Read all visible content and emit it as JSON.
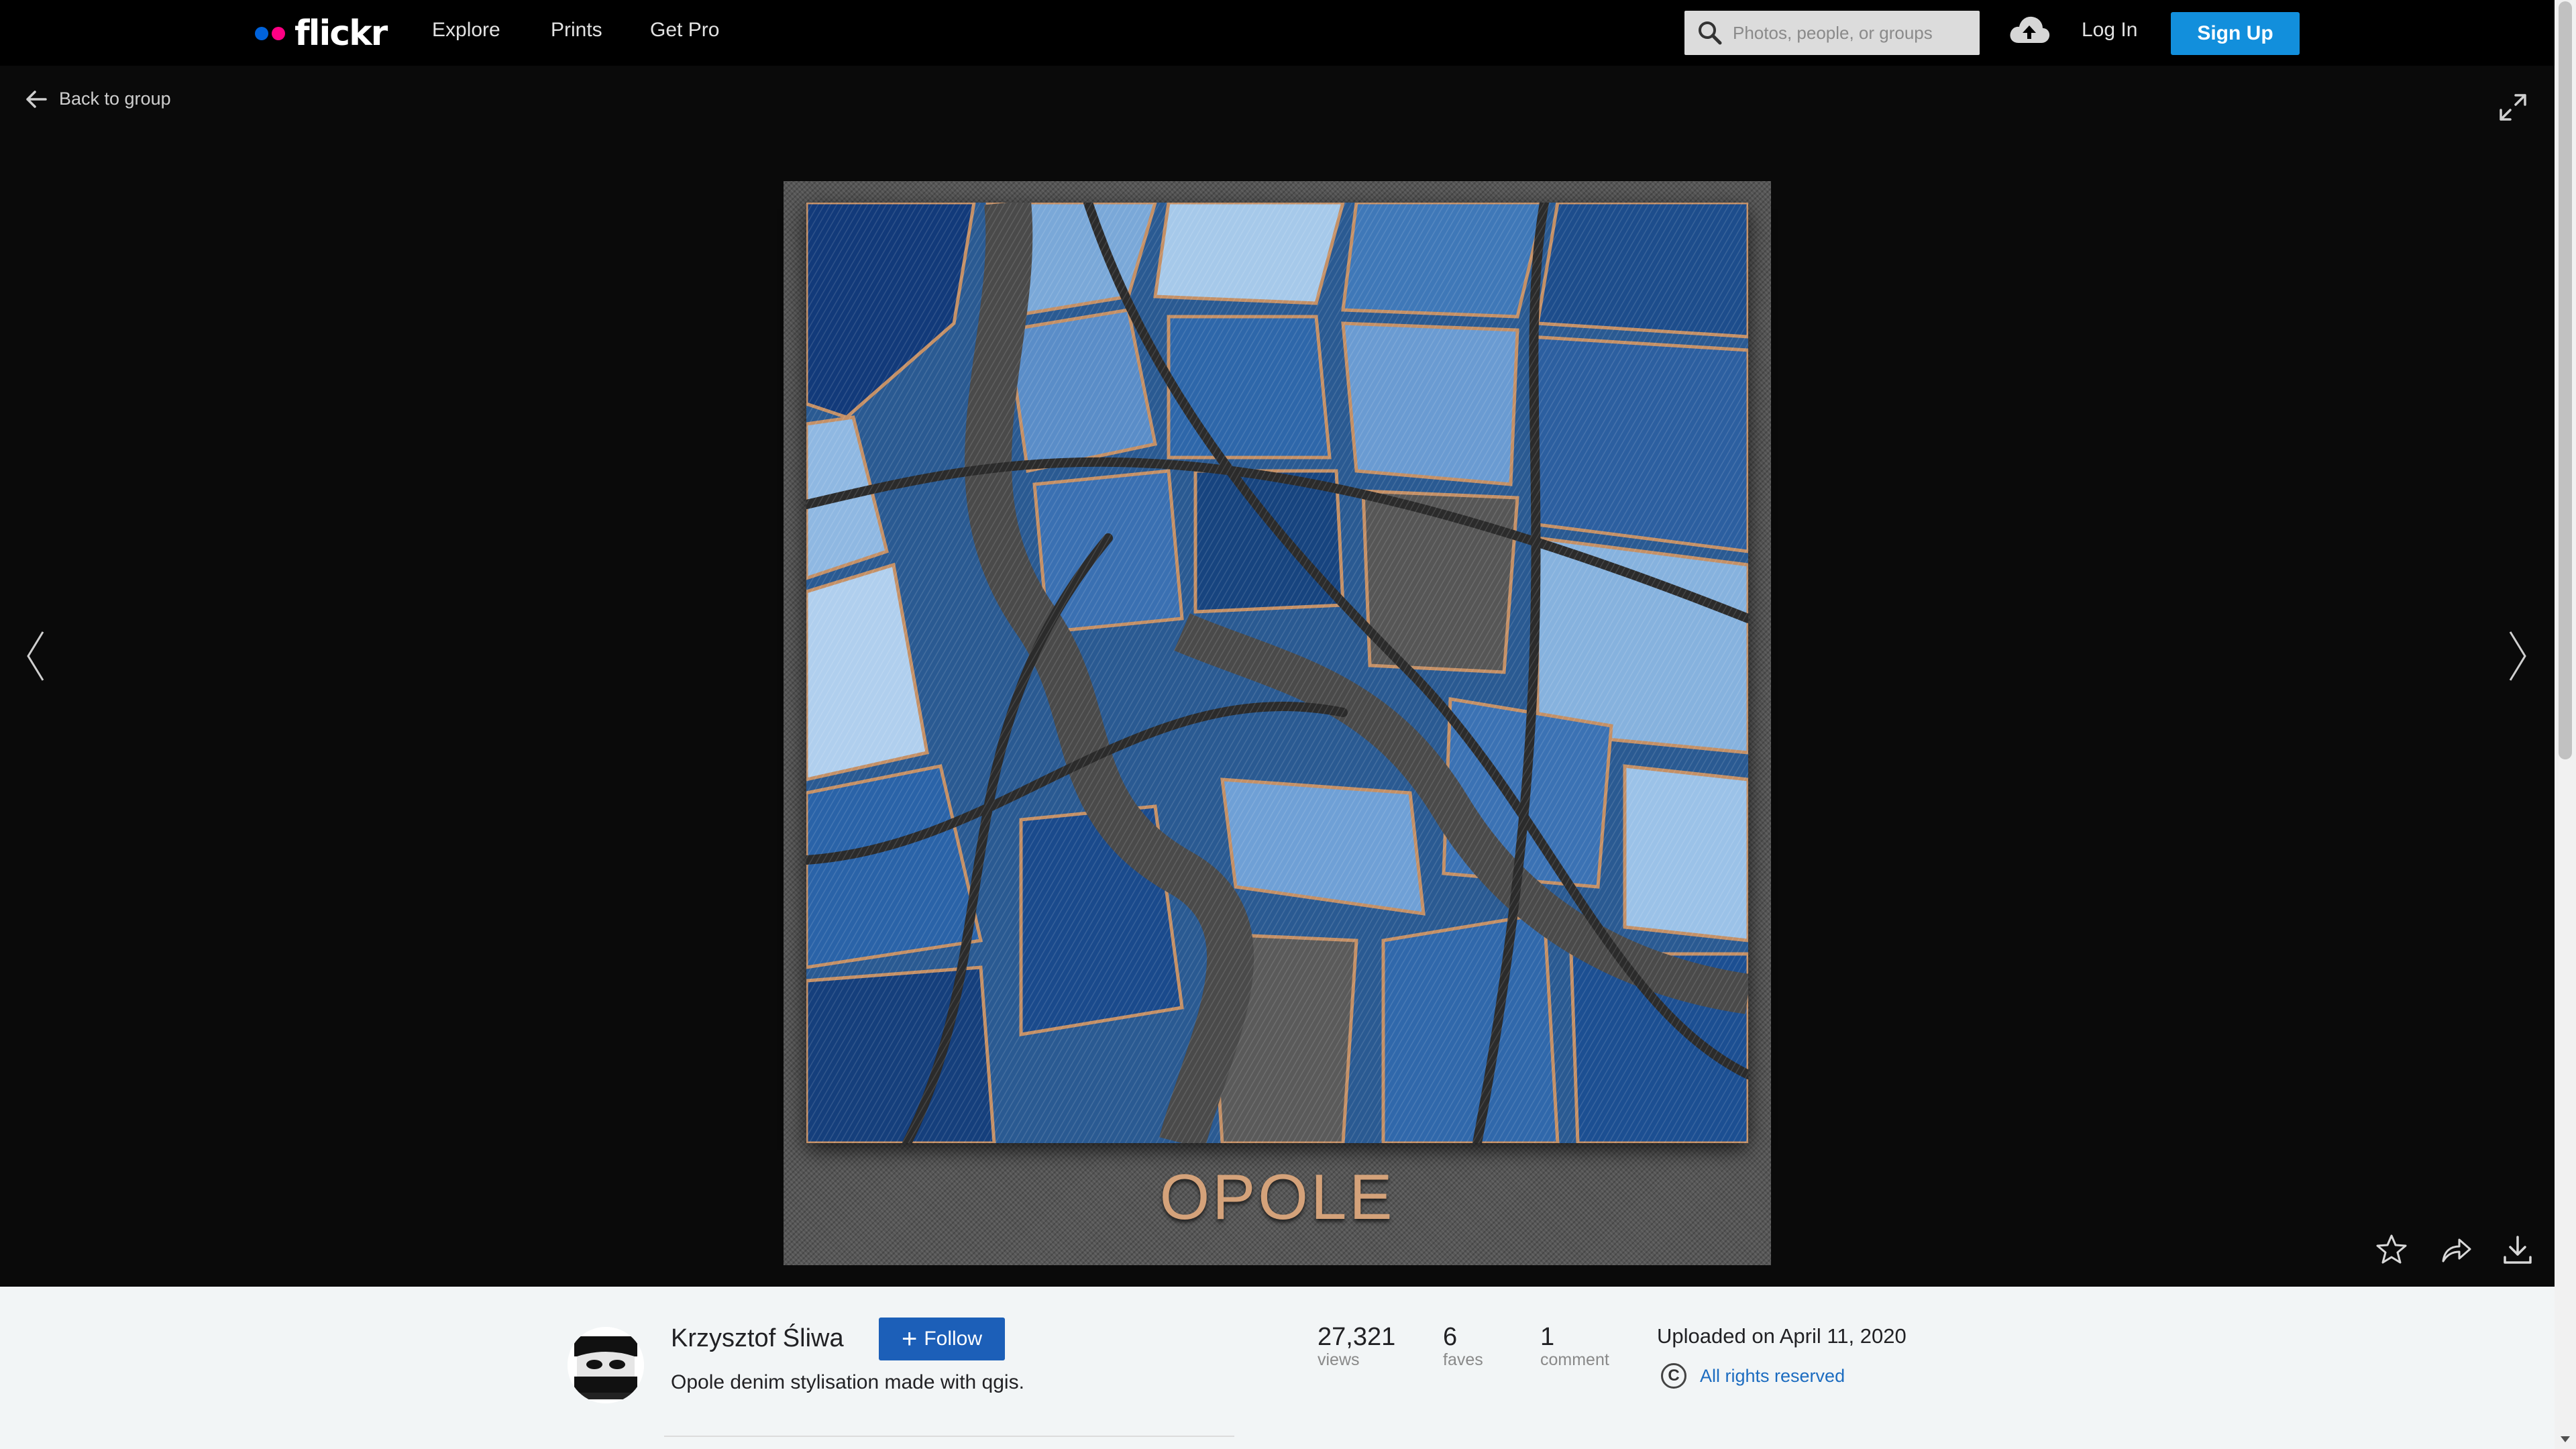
{
  "nav": {
    "logo": "flickr",
    "links": [
      "Explore",
      "Prints",
      "Get Pro"
    ],
    "search_placeholder": "Photos, people, or groups",
    "login": "Log In",
    "signup": "Sign Up"
  },
  "stage": {
    "back_label": "Back to group",
    "map_title": "OPOLE"
  },
  "info": {
    "author": "Krzysztof Śliwa",
    "follow": "Follow",
    "description": "Opole denim stylisation made with qgis.",
    "stats": [
      {
        "num": "27,321",
        "label": "views"
      },
      {
        "num": "6",
        "label": "faves"
      },
      {
        "num": "1",
        "label": "comment"
      }
    ],
    "uploaded": "Uploaded on April 11, 2020",
    "rights": "All rights reserved"
  },
  "colors": {
    "signup": "#128fdc",
    "follow": "#1c5fb8",
    "flickr_blue": "#0063dc",
    "flickr_pink": "#ff0084"
  }
}
